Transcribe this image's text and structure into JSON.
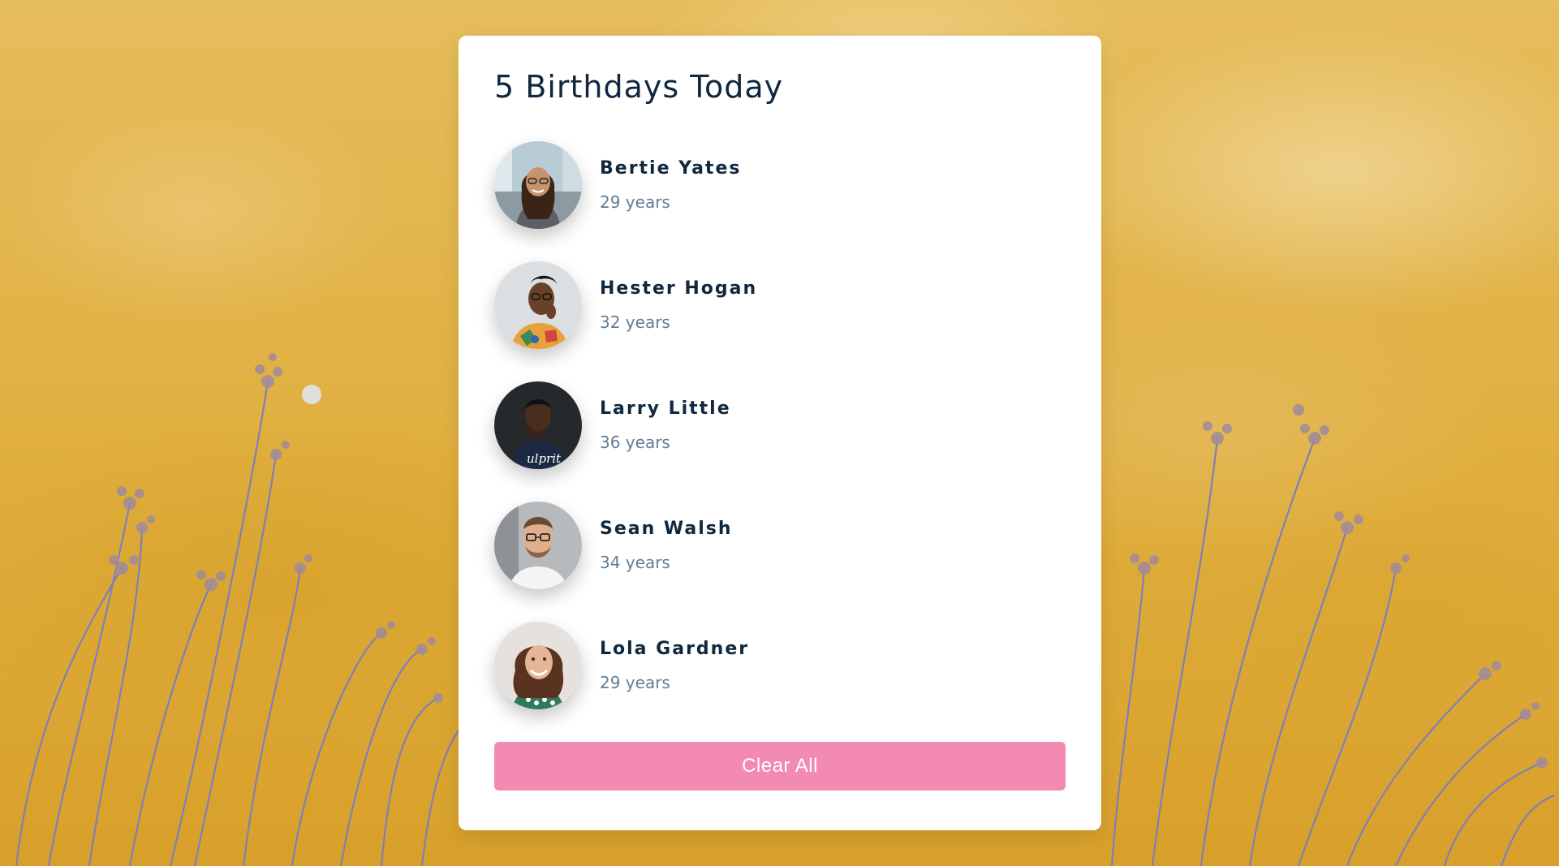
{
  "page_title": "5 Birthdays Today",
  "people": [
    {
      "name": "Bertie Yates",
      "age": "29 years",
      "avatar_icon": "portrait-woman-city-photo"
    },
    {
      "name": "Hester Hogan",
      "age": "32 years",
      "avatar_icon": "portrait-woman-glasses-photo"
    },
    {
      "name": "Larry Little",
      "age": "36 years",
      "avatar_icon": "portrait-man-dark-photo"
    },
    {
      "name": "Sean Walsh",
      "age": "34 years",
      "avatar_icon": "portrait-man-glasses-photo"
    },
    {
      "name": "Lola Gardner",
      "age": "29 years",
      "avatar_icon": "portrait-woman-curly-photo"
    }
  ],
  "clear_button_label": "Clear All",
  "colors": {
    "button": "#f28ab2",
    "heading": "#10273d",
    "age_text": "#617d98",
    "background": "#e2b54a"
  }
}
